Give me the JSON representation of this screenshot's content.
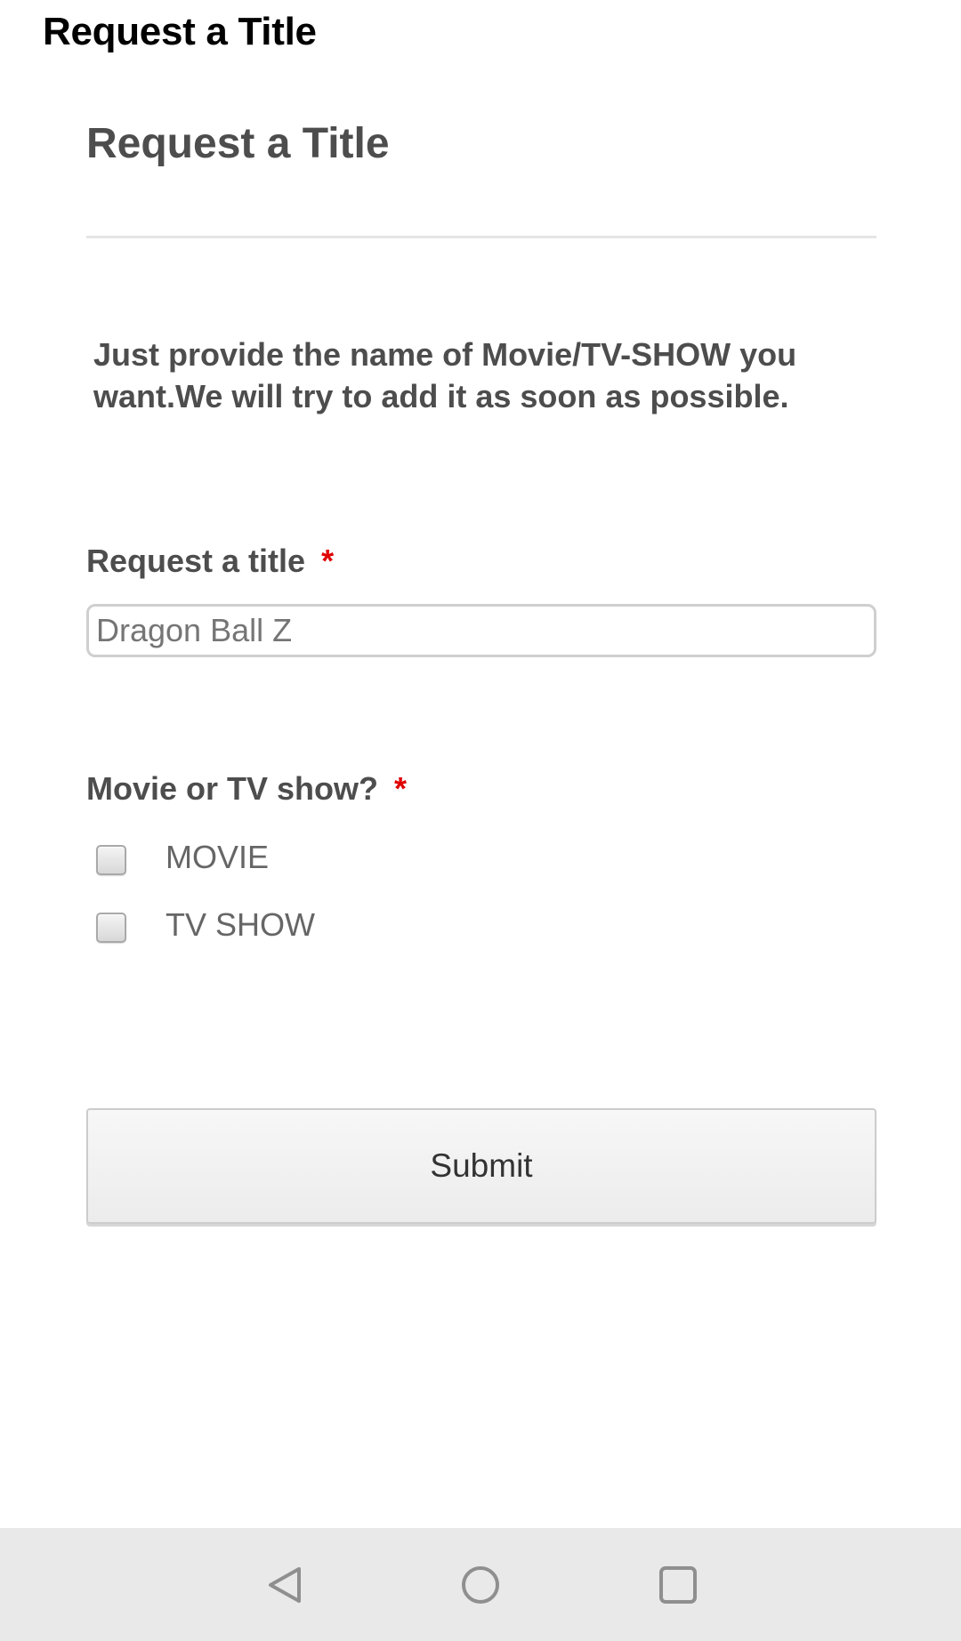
{
  "app": {
    "title": "Request a Title"
  },
  "form": {
    "heading": "Request a Title",
    "description": "Just provide the name of Movie/TV-SHOW you want.We will try to add it as soon as possible.",
    "title_field": {
      "label": "Request a title",
      "required_mark": "*",
      "placeholder": "Dragon Ball Z",
      "value": ""
    },
    "type_field": {
      "label": "Movie or TV show?",
      "required_mark": "*",
      "options": [
        {
          "label": "MOVIE",
          "checked": false
        },
        {
          "label": "TV SHOW",
          "checked": false
        }
      ]
    },
    "submit_label": "Submit"
  },
  "navigation": {
    "icons": [
      "back-icon",
      "home-icon",
      "recent-apps-icon"
    ]
  },
  "colors": {
    "required": "#e00000",
    "heading_text": "#4d4d4d",
    "nav_bar_bg": "#e9e9e9"
  }
}
